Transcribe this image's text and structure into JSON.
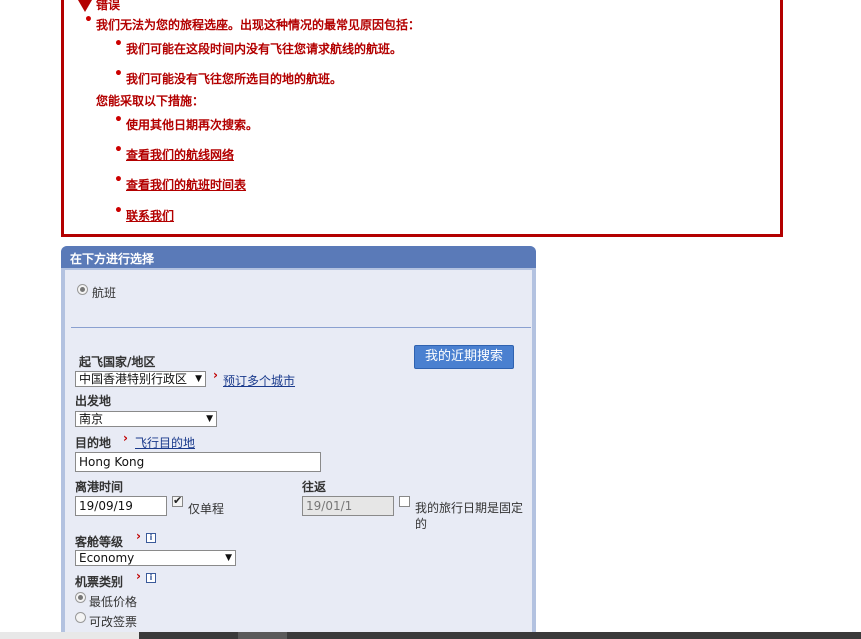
{
  "error": {
    "title": "错误",
    "reason_intro": "我们无法为您的旅程选座。出现这种情况的最常见原因包括：",
    "reasons": [
      "我们可能在这段时间内没有飞往您请求航线的航班。",
      "我们可能没有飞往您所选目的地的航班。"
    ],
    "actions_intro": "您能采取以下措施：",
    "actions": [
      "使用其他日期再次搜索。",
      "查看我们的航线网络",
      "查看我们的航班时间表",
      "联系我们"
    ]
  },
  "panel": {
    "header": "在下方进行选择",
    "trip_type": "航班",
    "recent_searches_button": "我的近期搜索",
    "origin_country_label": "起飞国家/地区",
    "origin_country_value": "中国香港特别行政区",
    "multi_city_link": "预订多个城市",
    "departure_label": "出发地",
    "departure_value": "南京",
    "destination_label": "目的地",
    "destination_link": "飞行目的地",
    "destination_value": "Hong Kong",
    "depart_date_label": "离港时间",
    "depart_date_value": "19/09/19",
    "one_way_label": "仅单程",
    "return_label": "往返",
    "return_date_value": "19/01/1",
    "fixed_dates_label": "我的旅行日期是固定的",
    "cabin_label": "客舱等级",
    "cabin_value": "Economy",
    "fare_type_label": "机票类别",
    "fare_options": [
      "最低价格",
      "可改签票"
    ],
    "info_glyph": "i",
    "chevron_glyph": "›",
    "dropdown_glyph": "▼",
    "bullet_glyph": "•"
  },
  "colors": {
    "error_red": "#b30000",
    "panel_header": "#5a7ab8",
    "panel_bg": "#e8ebf5",
    "button_blue": "#4a80d0"
  }
}
